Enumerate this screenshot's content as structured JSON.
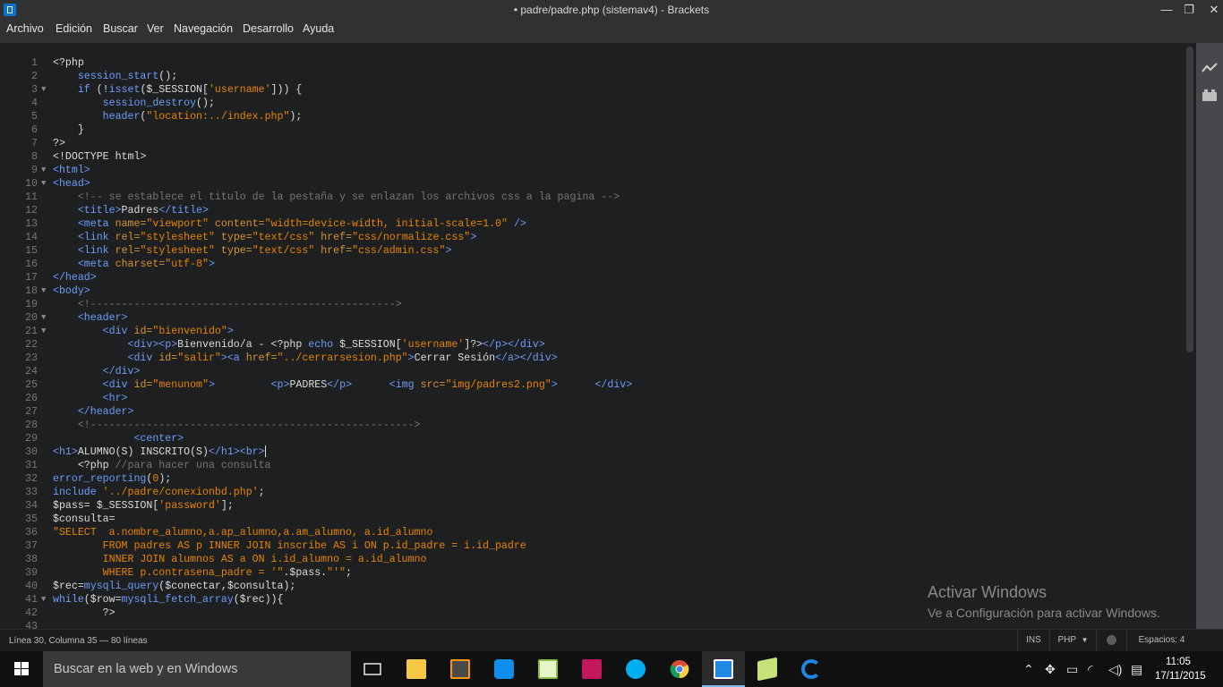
{
  "window": {
    "title": "• padre/padre.php (sistemav4) - Brackets",
    "minimize": "—",
    "maximize": "❐",
    "close": "✕"
  },
  "menu": [
    "Archivo",
    "Edición",
    "Buscar",
    "Ver",
    "Navegación",
    "Desarrollo",
    "Ayuda"
  ],
  "editor": {
    "lines": [
      {
        "n": "1",
        "fold": "",
        "html": "&lt;?php"
      },
      {
        "n": "2",
        "fold": "",
        "html": "    <span class='fn'>session_start</span>();"
      },
      {
        "n": "3",
        "fold": "▼",
        "html": "    <span class='kw'>if</span> (!<span class='fn'>isset</span>($_SESSION[<span class='str'>'username'</span>])) {"
      },
      {
        "n": "4",
        "fold": "",
        "html": "        <span class='fn'>session_destroy</span>();"
      },
      {
        "n": "5",
        "fold": "",
        "html": "        <span class='fn'>header</span>(<span class='str'>\"location:../index.php\"</span>);"
      },
      {
        "n": "6",
        "fold": "",
        "html": "    }"
      },
      {
        "n": "7",
        "fold": "",
        "html": "?&gt;"
      },
      {
        "n": "8",
        "fold": "",
        "html": "&lt;!DOCTYPE html&gt;"
      },
      {
        "n": "9",
        "fold": "▼",
        "html": "<span class='tag'>&lt;html&gt;</span>"
      },
      {
        "n": "10",
        "fold": "▼",
        "html": "<span class='tag'>&lt;head&gt;</span>"
      },
      {
        "n": "11",
        "fold": "",
        "html": "    <span class='cm'>&lt;!-- se establece el titulo de la pestaña y se enlazan los archivos css a la pagina --&gt;</span>"
      },
      {
        "n": "12",
        "fold": "",
        "html": "    <span class='tag'>&lt;title&gt;</span>Padres<span class='tag'>&lt;/title&gt;</span>"
      },
      {
        "n": "13",
        "fold": "",
        "html": "    <span class='tag'>&lt;meta</span> <span class='attr'>name=</span><span class='str'>\"viewport\"</span> <span class='attr'>content=</span><span class='str'>\"width=device-width, initial-scale=1.0\"</span> <span class='tag'>/&gt;</span>"
      },
      {
        "n": "14",
        "fold": "",
        "html": "    <span class='tag'>&lt;link</span> <span class='attr'>rel=</span><span class='str'>\"stylesheet\"</span> <span class='attr'>type=</span><span class='str'>\"text/css\"</span> <span class='attr'>href=</span><span class='str'>\"css/normalize.css\"</span><span class='tag'>&gt;</span>"
      },
      {
        "n": "15",
        "fold": "",
        "html": "    <span class='tag'>&lt;link</span> <span class='attr'>rel=</span><span class='str'>\"stylesheet\"</span> <span class='attr'>type=</span><span class='str'>\"text/css\"</span> <span class='attr'>href=</span><span class='str'>\"css/admin.css\"</span><span class='tag'>&gt;</span>"
      },
      {
        "n": "16",
        "fold": "",
        "html": "    <span class='tag'>&lt;meta</span> <span class='attr'>charset=</span><span class='str'>\"utf-8\"</span><span class='tag'>&gt;</span>"
      },
      {
        "n": "17",
        "fold": "",
        "html": "<span class='tag'>&lt;/head&gt;</span>"
      },
      {
        "n": "18",
        "fold": "▼",
        "html": "<span class='tag'>&lt;body&gt;</span>"
      },
      {
        "n": "19",
        "fold": "",
        "html": "    <span class='cm'>&lt;!-------------------------------------------------&gt;</span>"
      },
      {
        "n": "20",
        "fold": "▼",
        "html": "    <span class='tag'>&lt;header&gt;</span>"
      },
      {
        "n": "21",
        "fold": "▼",
        "html": "        <span class='tag'>&lt;div</span> <span class='attr'>id=</span><span class='str'>\"bienvenido\"</span><span class='tag'>&gt;</span>"
      },
      {
        "n": "22",
        "fold": "",
        "html": "            <span class='tag'>&lt;div&gt;&lt;p&gt;</span>Bienvenido/a - &lt;?php <span class='kw'>echo</span> $_SESSION[<span class='str'>'username'</span>]?&gt;<span class='tag'>&lt;/p&gt;&lt;/div&gt;</span>"
      },
      {
        "n": "23",
        "fold": "",
        "html": "            <span class='tag'>&lt;div</span> <span class='attr'>id=</span><span class='str'>\"salir\"</span><span class='tag'>&gt;&lt;a</span> <span class='attr'>href=</span><span class='str'>\"../cerrarsesion.php\"</span><span class='tag'>&gt;</span>Cerrar Sesión<span class='tag'>&lt;/a&gt;&lt;/div&gt;</span>"
      },
      {
        "n": "24",
        "fold": "",
        "html": "        <span class='tag'>&lt;/div&gt;</span>"
      },
      {
        "n": "25",
        "fold": "",
        "html": "        <span class='tag'>&lt;div</span> <span class='attr'>id=</span><span class='str'>\"menunom\"</span><span class='tag'>&gt;</span>         <span class='tag'>&lt;p&gt;</span>PADRES<span class='tag'>&lt;/p&gt;</span>      <span class='tag'>&lt;img</span> <span class='attr'>src=</span><span class='str'>\"img/padres2.png\"</span><span class='tag'>&gt;</span>      <span class='tag'>&lt;/div&gt;</span>"
      },
      {
        "n": "26",
        "fold": "",
        "html": "        <span class='tag'>&lt;hr&gt;</span>"
      },
      {
        "n": "27",
        "fold": "",
        "html": "    <span class='tag'>&lt;/header&gt;</span>"
      },
      {
        "n": "28",
        "fold": "",
        "html": "    <span class='cm'>&lt;!----------------------------------------------------&gt;</span>"
      },
      {
        "n": "29",
        "fold": "",
        "html": "             <span class='tag'>&lt;center&gt;</span>"
      },
      {
        "n": "30",
        "fold": "",
        "html": "<span class='tag'>&lt;h1&gt;</span>ALUMNO(S) INSCRITO(S)<span class='tag'>&lt;/h1&gt;&lt;br&gt;</span><span class='cursor'></span>"
      },
      {
        "n": "31",
        "fold": "",
        "html": "    &lt;?php <span class='cm'>//para hacer una consulta</span>"
      },
      {
        "n": "32",
        "fold": "",
        "html": "<span class='fn'>error_reporting</span>(<span class='str'>0</span>);"
      },
      {
        "n": "33",
        "fold": "",
        "html": "<span class='kw'>include</span> <span class='str'>'../padre/conexionbd.php'</span>;"
      },
      {
        "n": "34",
        "fold": "",
        "html": "$pass= $_SESSION[<span class='str'>'password'</span>];"
      },
      {
        "n": "35",
        "fold": "",
        "html": "$consulta="
      },
      {
        "n": "36",
        "fold": "",
        "html": "<span class='str'>\"SELECT  a.nombre_alumno,a.ap_alumno,a.am_alumno, a.id_alumno</span>"
      },
      {
        "n": "37",
        "fold": "",
        "html": "<span class='str'>        FROM padres AS p INNER JOIN inscribe AS i ON p.id_padre = i.id_padre</span>"
      },
      {
        "n": "38",
        "fold": "",
        "html": "<span class='str'>        INNER JOIN alumnos AS a ON i.id_alumno = a.id_alumno</span>"
      },
      {
        "n": "39",
        "fold": "",
        "html": "<span class='str'>        WHERE p.contrasena_padre = '\"</span>.$pass.<span class='str'>\"'\"</span>;"
      },
      {
        "n": "40",
        "fold": "",
        "html": "$rec=<span class='fn'>mysqli_query</span>($conectar,$consulta);"
      },
      {
        "n": "41",
        "fold": "▼",
        "html": "<span class='kw'>while</span>($row=<span class='fn'>mysqli_fetch_array</span>($rec)){"
      },
      {
        "n": "42",
        "fold": "",
        "html": "        ?&gt;"
      },
      {
        "n": "43",
        "fold": "",
        "html": ""
      }
    ]
  },
  "watermark": {
    "title": "Activar Windows",
    "subtitle": "Ve a Configuración para activar Windows."
  },
  "status": {
    "position": "Línea 30, Columna 35 — 80 líneas",
    "mode": "INS",
    "language": "PHP",
    "language_arrow": "▼",
    "indent": "Espacios: 4"
  },
  "taskbar": {
    "search_placeholder": "Buscar en la web y en Windows",
    "time": "11:05",
    "date": "17/11/2015",
    "apps": [
      {
        "name": "task-view-icon",
        "color": "#e6e6e6"
      },
      {
        "name": "file-explorer-icon",
        "color": "#f4c744"
      },
      {
        "name": "sublime-text-icon",
        "color": "#ff9800"
      },
      {
        "name": "teamviewer-icon",
        "color": "#0e8ee9"
      },
      {
        "name": "notepad-plus-icon",
        "color": "#8bc34a"
      },
      {
        "name": "phpstorm-icon",
        "color": "#c2185b"
      },
      {
        "name": "skype-icon",
        "color": "#00aff0"
      },
      {
        "name": "chrome-icon",
        "color": "#dd4b39"
      },
      {
        "name": "brackets-icon",
        "color": "#1e88e5"
      },
      {
        "name": "folder-icon",
        "color": "#c7e27a"
      },
      {
        "name": "edge-icon",
        "color": "#1e88e5"
      }
    ]
  }
}
